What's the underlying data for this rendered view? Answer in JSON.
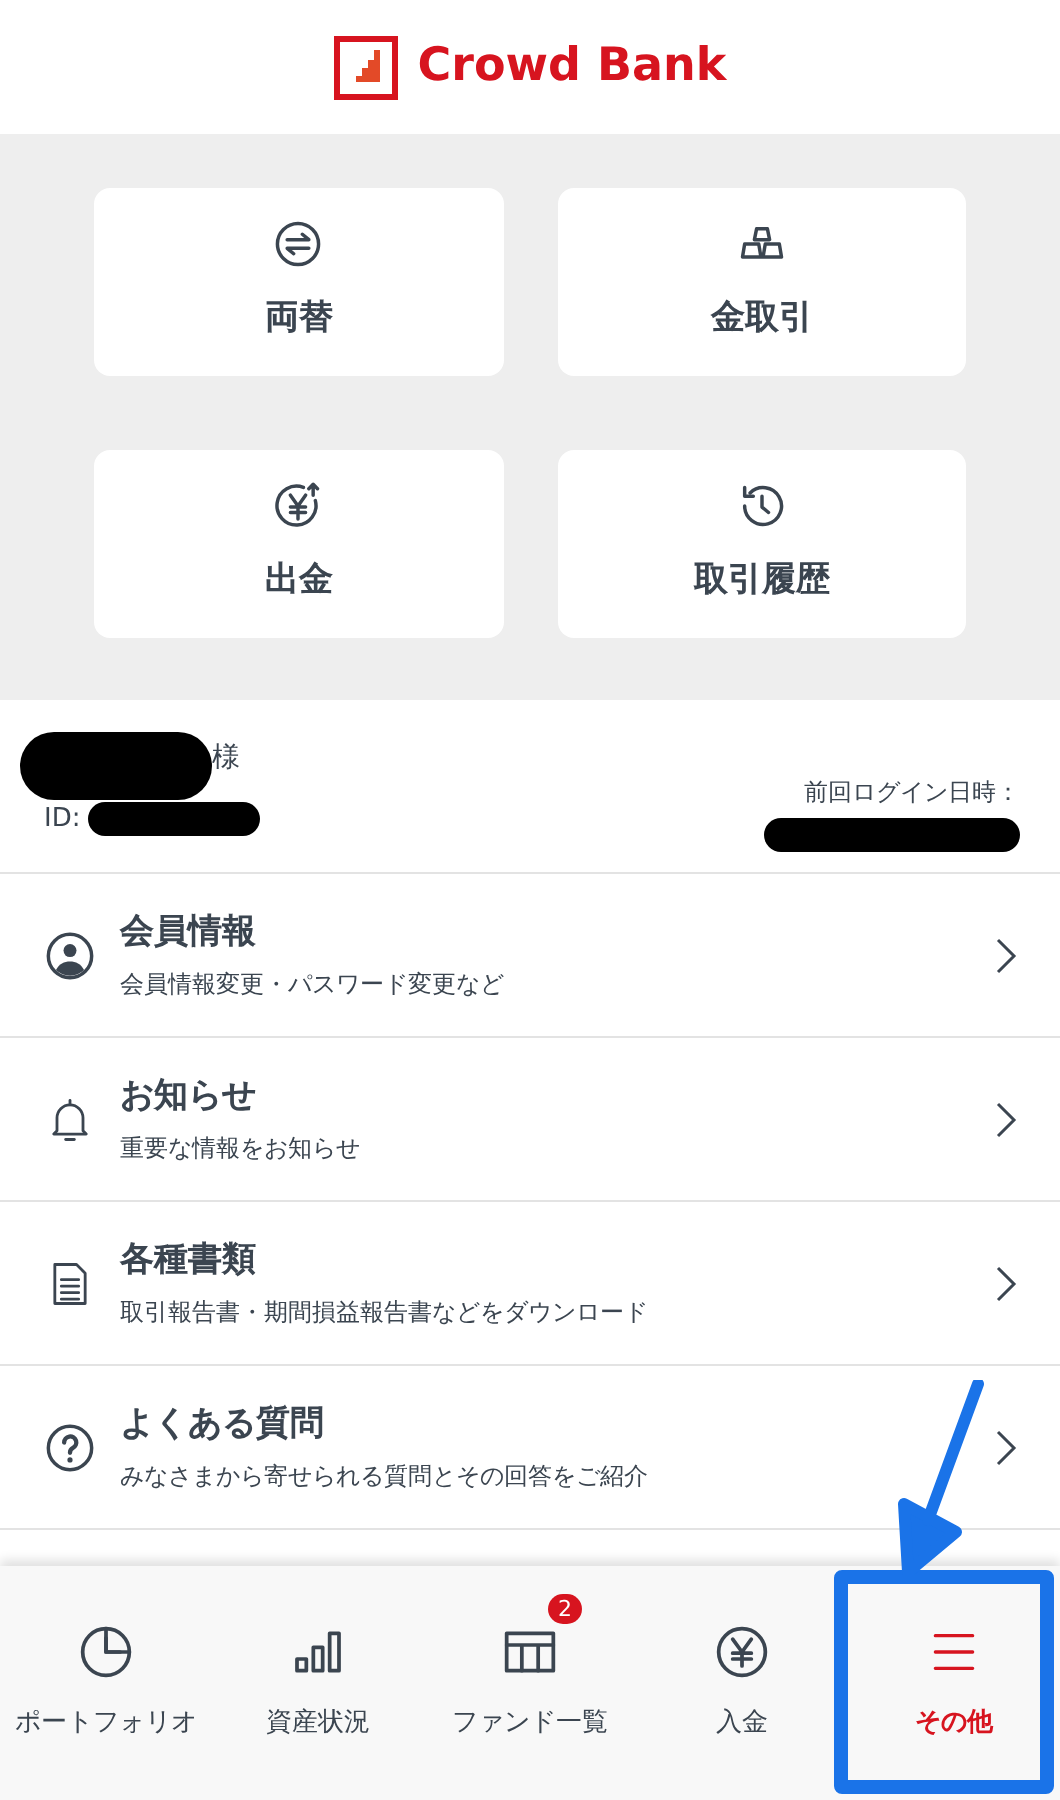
{
  "header": {
    "logo_text": "Crowd Bank"
  },
  "quick_actions": [
    {
      "label": "両替"
    },
    {
      "label": "金取引"
    },
    {
      "label": "出金"
    },
    {
      "label": "取引履歴"
    }
  ],
  "account": {
    "honorific": "様",
    "id_label": "ID:",
    "last_login_label": "前回ログイン日時："
  },
  "menu_items": [
    {
      "title": "会員情報",
      "subtitle": "会員情報変更・パスワード変更など"
    },
    {
      "title": "お知らせ",
      "subtitle": "重要な情報をお知らせ"
    },
    {
      "title": "各種書類",
      "subtitle": "取引報告書・期間損益報告書などをダウンロード"
    },
    {
      "title": "よくある質問",
      "subtitle": "みなさまから寄せられる質問とその回答をご紹介"
    }
  ],
  "tab_bar": [
    {
      "label": "ポートフォリオ",
      "selected": false
    },
    {
      "label": "資産状況",
      "selected": false
    },
    {
      "label": "ファンド一覧",
      "selected": false,
      "badge": "2"
    },
    {
      "label": "入金",
      "selected": false
    },
    {
      "label": "その他",
      "selected": true
    }
  ]
}
